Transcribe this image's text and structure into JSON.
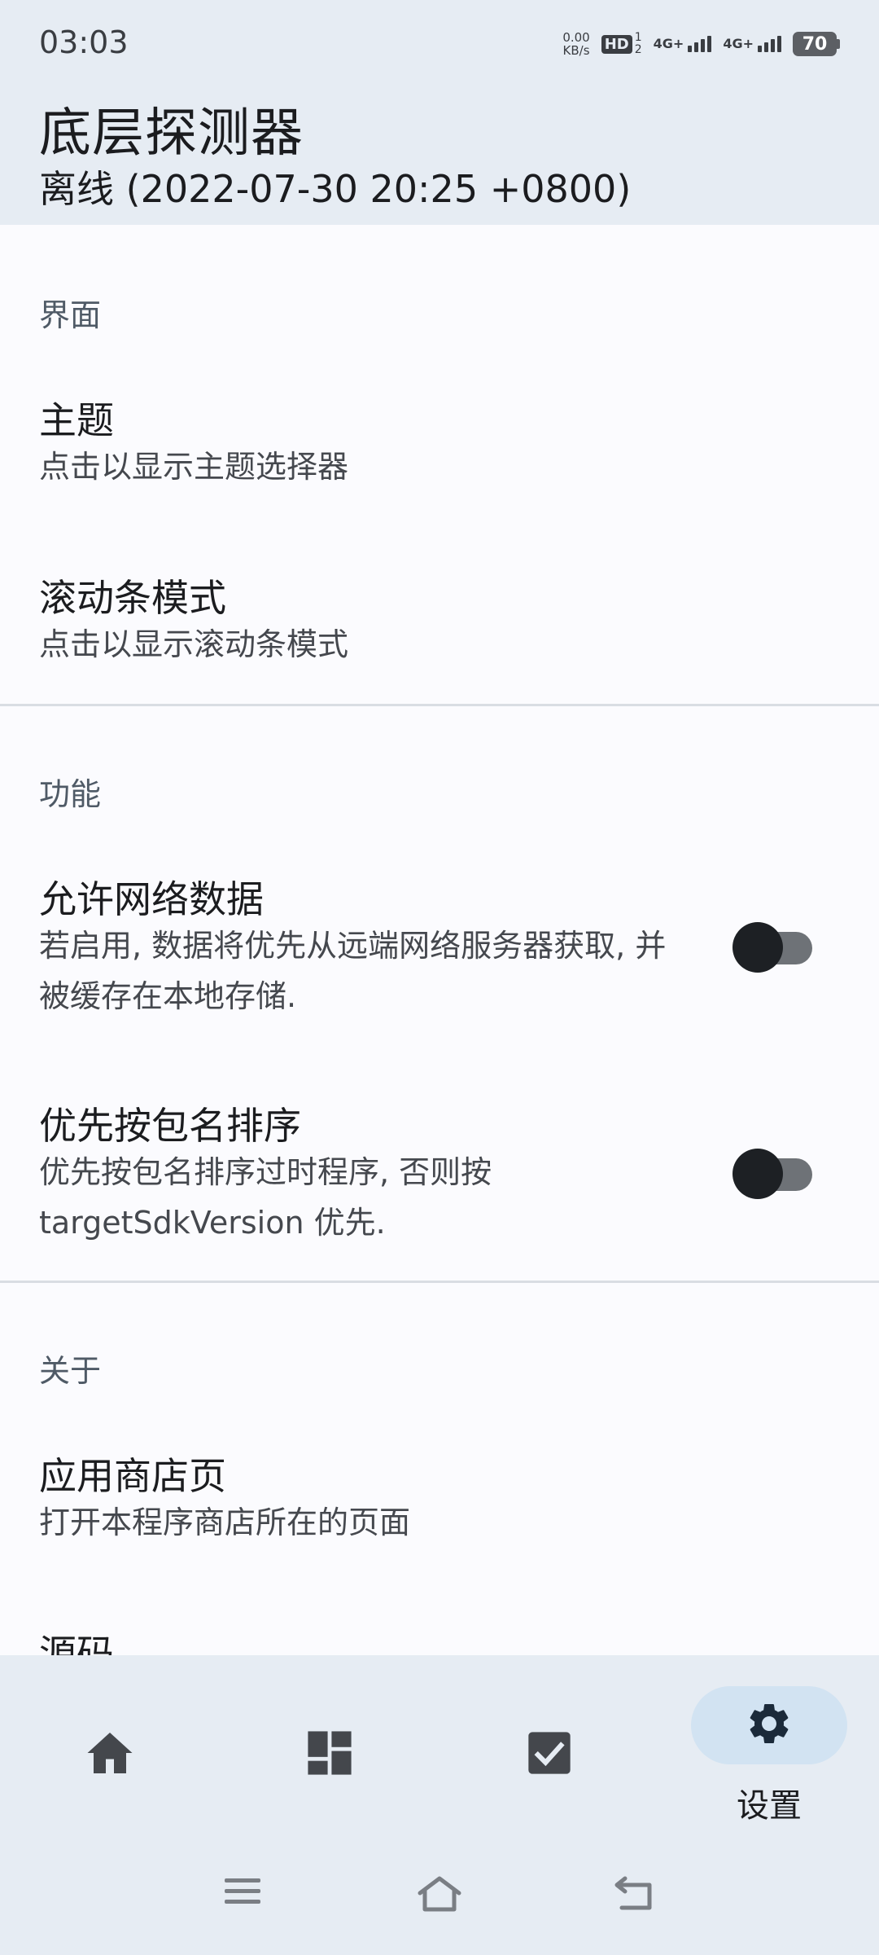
{
  "status_bar": {
    "time": "03:03",
    "net_speed_value": "0.00",
    "net_speed_unit": "KB/s",
    "hd_label": "HD",
    "hd_sim_top": "1",
    "hd_sim_bottom": "2",
    "signal1_label": "4G+",
    "signal2_label": "4G+",
    "battery": "70"
  },
  "header": {
    "title": "底层探测器",
    "subtitle": "离线 (2022-07-30 20:25 +0800)"
  },
  "sections": {
    "interface": {
      "title": "界面",
      "theme_title": "主题",
      "theme_summary": "点击以显示主题选择器",
      "scrollbar_title": "滚动条模式",
      "scrollbar_summary": "点击以显示滚动条模式"
    },
    "features": {
      "title": "功能",
      "network_title": "允许网络数据",
      "network_summary": "若启用, 数据将优先从远端网络服务器获取, 并被缓存在本地存储.",
      "network_enabled": false,
      "sort_title": "优先按包名排序",
      "sort_summary": "优先按包名排序过时程序, 否则按 targetSdkVersion 优先.",
      "sort_enabled": false
    },
    "about": {
      "title": "关于",
      "store_title": "应用商店页",
      "store_summary": "打开本程序商店所在的页面",
      "source_title": "源码"
    }
  },
  "bottom_nav": {
    "items": [
      {
        "icon": "home-icon",
        "label": "",
        "selected": false
      },
      {
        "icon": "dashboard-icon",
        "label": "",
        "selected": false
      },
      {
        "icon": "checkbox-icon",
        "label": "",
        "selected": false
      },
      {
        "icon": "gear-icon",
        "label": "设置",
        "selected": true
      }
    ]
  },
  "colors": {
    "header_bg": "#e6ecf3",
    "content_bg": "#fbfbfe",
    "selected_pill": "#d2e3f2",
    "switch_thumb": "#1d2024",
    "switch_track": "#6e7277"
  }
}
